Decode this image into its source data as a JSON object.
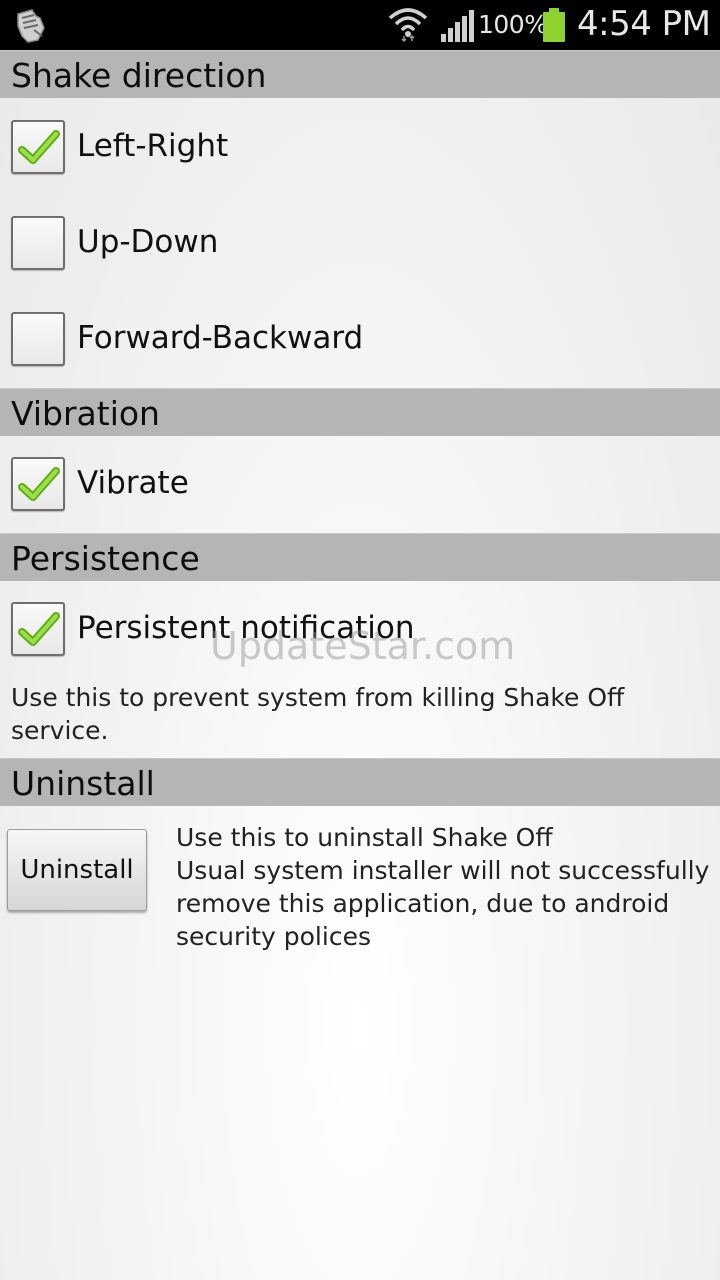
{
  "status_bar": {
    "battery_percent": "100%",
    "time": "4:54 PM",
    "icons": [
      "app-notification-icon",
      "wifi-icon",
      "signal-icon",
      "battery-icon"
    ],
    "battery_color": "#8fd12f"
  },
  "sections": {
    "shake_direction": {
      "title": "Shake direction",
      "options": [
        {
          "label": "Left-Right",
          "checked": true
        },
        {
          "label": "Up-Down",
          "checked": false
        },
        {
          "label": "Forward-Backward",
          "checked": false
        }
      ]
    },
    "vibration": {
      "title": "Vibration",
      "options": [
        {
          "label": "Vibrate",
          "checked": true
        }
      ]
    },
    "persistence": {
      "title": "Persistence",
      "options": [
        {
          "label": "Persistent notification",
          "checked": true
        }
      ],
      "description": "Use this to prevent system from killing Shake Off service."
    },
    "uninstall": {
      "title": "Uninstall",
      "button_label": "Uninstall",
      "description_lines": [
        "Use this to uninstall Shake Off",
        "Usual system installer will not successfully",
        "remove this application, due to android",
        "security polices"
      ]
    }
  },
  "watermark": "UpdateStar.com",
  "colors": {
    "check_green": "#7fd126",
    "header_bg": "#b5b5b5",
    "statusbar_bg": "#000000"
  }
}
